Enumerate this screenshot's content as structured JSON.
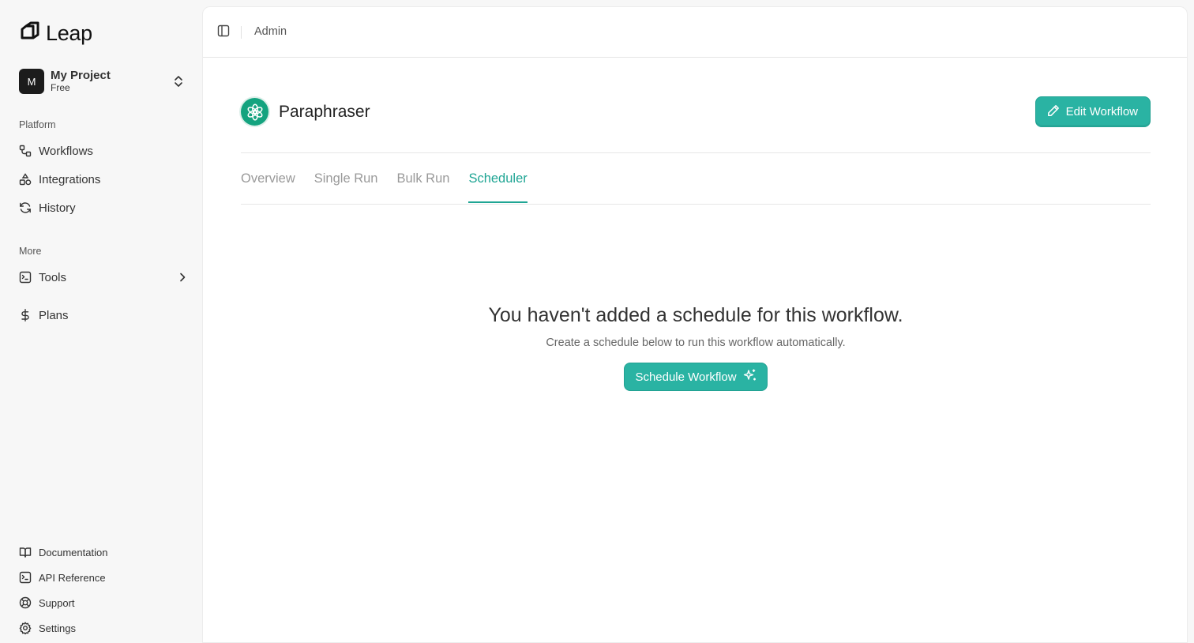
{
  "app": {
    "name": "Leap"
  },
  "project": {
    "avatar_letter": "M",
    "name": "My Project",
    "plan": "Free"
  },
  "sidebar": {
    "platform_label": "Platform",
    "platform_items": [
      {
        "label": "Workflows",
        "icon": "workflow-icon"
      },
      {
        "label": "Integrations",
        "icon": "shapes-icon"
      },
      {
        "label": "History",
        "icon": "refresh-icon"
      }
    ],
    "more_label": "More",
    "more_items": [
      {
        "label": "Tools",
        "icon": "terminal-icon"
      },
      {
        "label": "Plans",
        "icon": "dollar-icon"
      }
    ],
    "footer_items": [
      {
        "label": "Documentation",
        "icon": "book-icon"
      },
      {
        "label": "API Reference",
        "icon": "terminal-icon"
      },
      {
        "label": "Support",
        "icon": "lifebuoy-icon"
      },
      {
        "label": "Settings",
        "icon": "gear-icon"
      }
    ]
  },
  "topbar": {
    "breadcrumb": "Admin"
  },
  "workflow": {
    "title": "Paraphraser",
    "edit_button": "Edit Workflow",
    "tabs": [
      "Overview",
      "Single Run",
      "Bulk Run",
      "Scheduler"
    ],
    "active_tab": "Scheduler"
  },
  "empty_state": {
    "title": "You haven't added a schedule for this workflow.",
    "subtitle": "Create a schedule below to run this workflow automatically.",
    "button": "Schedule Workflow"
  },
  "colors": {
    "accent": "#2ab3a3",
    "accent_text": "#1fa594",
    "workflow_icon_bg": "#14a37f"
  }
}
